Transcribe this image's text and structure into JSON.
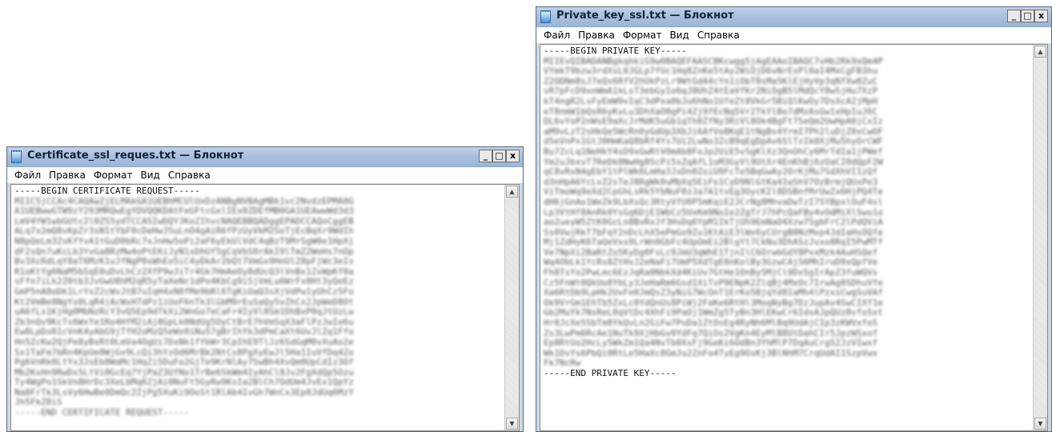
{
  "windows": {
    "cert": {
      "title": "Certificate_ssl_reques.txt — Блокнот",
      "controls": {
        "minimize": "_",
        "maximize": "□",
        "close": "x"
      },
      "menu": [
        "Файл",
        "Правка",
        "Формат",
        "Вид",
        "Справка"
      ],
      "content": {
        "begin_line": "-----BEGIN CERTIFICATE REQUEST-----",
        "blurred_lines": [
          "MIIC5jCCAc4CAQAwZjELMAkGA1UEBhMCUlUxDzANBgNVBAgMBk1vc2NvdzEPMA0G",
          "A1UEBwwGTW9zY293MRQwEgYDVQQKDAtFeGFtcGxlIEx0ZDEfMB0GA1UEAwwWd3d3",
          "LmV4YW1wbGUtc2l0ZS5ydTCCASIwDQYJKoZIhvcNAQEBBQADggEPADCCAQoCggEB",
          "ALq7x2mQ8vKpZr3sN1tYbF0cDeHwJ5uLnO4gAiR6fPzUyVkM2SoTjEcBqXr9WdIh",
          "N8pQeLm3ZsKfYvA1tGuD0bRc7xJnHw5oPi2aF6yEkUlVdC4qBzT9MrSgW0e1HpXj",
          "dF2sQn7uKcLb3YvGa8RzMw4oPtE6iJyN1xDhUf5gCqVbS0rAkI9lTmZ2WeHs7nOp",
          "Bv3XcRdLqY8aT6MzK1uJfNgP0sWhEo5iC4yDkAr2bQt7VmGx9HnUlZ8pFjWc3eIs",
          "R1oKtYg6NaM5bSqE0uDvLhCz2XfP9wJiTr4Gk7HmAeOy8dUcQ3lVnBx1ZsWpKf0a",
          "sFfn7iLk2Z0tb3JvGwU8hM2qR5yTaXeNc1dPo4KbCg9iSjVmLu6WrFx0Ht3yQeEz",
          "GmP5nA8oDk1LrYsZ2cWvJtB7uIqH4xN0fMe9bRl6TgKiOaQ3sXjVdPw1yUhCz5Fo",
          "Kt2VmBe8NgYs0LqR4jAcWxH7dPz1iUoF6nTk3lGbM9rEuSaQy5vZhCx2JpWeD8Ot",
          "uA6fLs1KjHg0MbNzRcY3vQ5Ep9dTkXi2WnGo7eCaFr4IyVl8Sm1DhBxP0qJtUzLw",
          "Zb3nQv9KcTs6WxYe1Ro4HfM2iAj8GpLk0NdUg5OyCtBrE7hVmSqX3aFlPzJwIe6u",
          "Ew8LpDsR1cVnK4yAbG9jTfH2oMzQ5eWx0iNuS7gBrIhYk3dPmCaXt6UvJlZq1Ffo",
          "Hn5ZcKw2QjPe8yBsRt0LmVa4OgUi7DxNk1fYbWr3CpIhE9TlJz6SdGqM0vXuAo2e",
          "Sx1TaFm7bRn4KpUe0WjGv9LcQi3hYzOd6MrBk2NtCs8PgXyEwJl5Ha1IuVfDq4Zo",
          "Pg6VnRk0LtYx3JsEb8WaMc1HqZi5DuFo2GjTe9KrNlAy7SwBh4XvQm0UpCdIz3Of",
          "Mb2KsHn9RwDx5LtVi0GcEq7YjPaZ3UfNo1TrBe6SkWm4IyAhCl8Jv2FgXdQp5Ozu",
          "Ty4WgPo1SkVn8HrDc3XeLbMq6ZjAi0NuFt5GyRw9KsIa2BlCh7OdUm4JvEx1QpYz",
          "Na8FrTk3LsVy6HwBe0DmQc2ZjPg5XuKi9OoSt1RlAb4IvGh7WnCx3Ep0JdUq6MzY",
          "Jh5FkZ8iS"
        ],
        "end_line": "-----END CERTIFICATE REQUEST-----"
      }
    },
    "key": {
      "title": "Private_key_ssl.txt — Блокнот",
      "controls": {
        "minimize": "_",
        "maximize": "□",
        "close": "x"
      },
      "menu": [
        "Файл",
        "Правка",
        "Формат",
        "Вид",
        "Справка"
      ],
      "content": {
        "begin_line": "-----BEGIN PRIVATE KEY-----",
        "blurred_lines": [
          "MIIEvQIBADANBgkqhkiG9w0BAQEFAASCBKcwggSjAgEAAoIBAQC7vHb2Rk9xQm4P",
          "VYmkT9bzw3rdXsL0JGLp7fUc1Hq8ZnKe5tAy2WiOjD6vNrEsPl0aI4MxCgFB3hu",
          "Z2ODNm8sJ7eQx6RfV2hUkPzLr9WtGdA4cYn1iObT0sMa5KlEjHyVp3qNfXw8ZuC",
          "vR7pFcD9xnWmA1kLsT3ebGyIo6qJ0UhZ4tEaVfKr2NiOgB5lMdQcY8wSjHu7XzP",
          "kT4ngR2LsFyEmW9vIqC3dPxa0bJu6hNo1UfeZt8VkGr5BiQlKwOy7DsXcA2jMpH",
          "eT8nmW1bQsR6yKvLu3DhXaO0gPi4Zj9fEcNq5Vr2TkYlBo7dMzAsGw1xHpIuJ6C",
          "DL6vYoP2nWsE9aXcJrMdK5uGb1qTh0ZfNy3RiVl8Ok4BgFt7SeQm2UwHpA0jCxIz",
          "aM9vLzT2sHkQe5WcRn0yGdUp3XbJi6AfVo8KqE1tNgBs4YrmI7Ph2luDjZ0xCwOF",
          "d5eVnPx1GtJ0HmKaQ8bRf4Ys7Ui2LwNo3ZcB9qEgDpAv6SlTzIk0XjMu5hyOrCWF",
          "Bu7ZcLq1NeHkY4sD9xGwRtV0mAb8FoJp2UiE5vSgKlXz3QnOhCy6MrTdIa1jPWef",
          "Ym2uJbxvT7ReDk0NwHg8ScPi5sZqAfL1oM3GyVl9UtXr4EnKhBj6zOaCI0dQpF2W",
          "qC8vRsN4gEbY1tPlWk6LmHa3JxDn0ZoiU9FcTe5BqGwAy2OrKjMu7SdXhVI1zQf",
          "d3nHpA6YcLvZ2sTeJ8RgWk0uMbXq5EiFo1CyD9NlGtKa4IwShV7OzBrmjQUxPe3",
          "ViTmoWq9eXd2CpGhLsRk5YbNuF0zJa7A1tvEg3OycKIl8DSBnfMrUwZx6HjPQ4Te",
          "dH6jGnAo1WeZk9LbXsQc3RtyVfU0P5mKqiE2JCrNg8MhvaDwTzI7SYBpxlOuF4sl",
          "Lp3VtHf8AnRk0YsGq6DjE1WbCz5UxKm9NoIe2ZgTrJ7hPcQaFBy4vOdMiXlSwu1o",
          "ao2ueyW5ZtK0GcLn8BvRxJf3HsDq6YpM1IkTjUh9EmNaO4Xzw7SgbFrC2lPdQViA",
          "Ss0VwjRkT7bFqY2nDcLhX5ePmGo9Zu1KtAiE3lWx6yCUrgB8NzMvp4JdIaHsOQfe",
          "Mj1ZdHyK6TaQeVxs9LrWn0GbFc4UpOmEi2BlgYt7CkNu3DhASzJvxo8RqI5PwMTf",
          "Ve7NpXi2BaRtZo5KyDg0FsLc9JmU3qWhE1TjnIlC6OrwbGdY8PvxMzk4AuHSQef",
          "Wq4ObLk1YcRs8ZtHvJ2eNaFi7UmP5XdTgE0nKolBy3GzwCAjS6MhIruD9xQpfVe",
          "Fh8TsYo2PwLmc6EzJqRa0NbkXd4KiUv7GtHe1OnBy5MjCl9DxSgIrApZ3fuWQVs",
          "Cz5FnWt0QkUo8YbLy3JeHaRm6Gsd1XiTvP9ENpK2ZlqBj4MxOc7IrwAg0SDhuVfe",
          "Xa6RtDb9LpHk2UvFe0JmQsZ3yNiG7WcOnT1ErKo5BjqYd8IaMh4lPzxsCwgSuVAf",
          "Ok9VrGm1EhTb5ZxLc0YdQnUs8PiWj2FaKe6RtHl3MoqNyBg7DzJupAv4SwCIXf1e",
          "Gb2MuYk7NsReL0qVtDc4XhFi9PaOj1WmZg5TyBn3HlEKwCr6IdsAJpQUz8vfoSxt",
          "Hr0JcXe5SbTm8YkQvLn2GiFw7PuDa1ZtOsEg4RyNh6MlBq9UdAjCIp3zKWVxfoS",
          "Zs3LwPm6RcAe1NuTk9XjHbGv0YdFq7QiOs2VgKn4EyMlB8UtDahCIr5JpzWSxof",
          "Ep8RtUo2HcLy5WkZm1Qa4NvTb0XsFj9GeKi6OdBn3YhMlP7DqAuCrgS2JzVIwxf",
          "Wk1DvYs6PbQi0RtLe5HaXc8GmJu2ZnFo4TyEg9OsKj3BlNhM7CrqUdAI1SzpVwx",
          "Fk7NcRw"
        ],
        "end_line": "-----END PRIVATE KEY-----"
      }
    }
  }
}
